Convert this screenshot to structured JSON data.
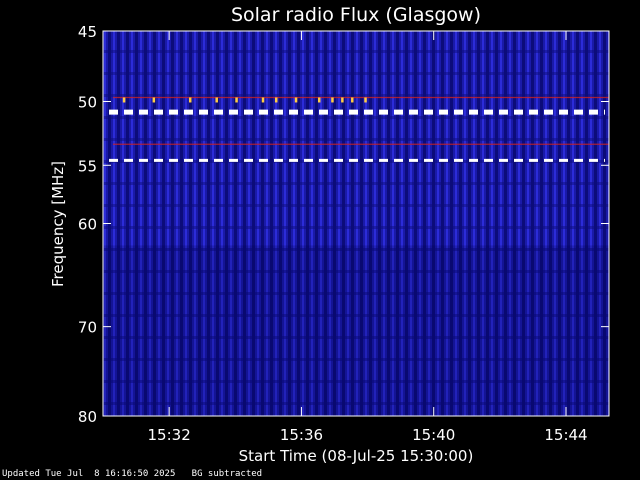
{
  "chart_data": {
    "type": "heatmap",
    "title": "Solar radio Flux (Glasgow)",
    "xlabel": "Start Time (08-Jul-25 15:30:00)",
    "ylabel": "Frequency [MHz]",
    "x_range_minutes": [
      0,
      15.3
    ],
    "x_ticks": [
      {
        "minute": 2,
        "label": "15:32"
      },
      {
        "minute": 6,
        "label": "15:36"
      },
      {
        "minute": 10,
        "label": "15:40"
      },
      {
        "minute": 14,
        "label": "15:44"
      }
    ],
    "y_range_mhz": [
      45,
      80
    ],
    "y_scale": "log",
    "y_ticks": [
      45,
      50,
      55,
      60,
      70,
      80
    ],
    "colors": {
      "background": "#000000",
      "plot_base": "#1a1aa8",
      "stripe_dark": "#0c0c7a",
      "stripe_bright": "#3a3aff",
      "rfi_line": "#ffffff",
      "rfi_hot": "#ffcc44",
      "rfi_red": "#cc2222"
    },
    "interference_lines_mhz": [
      50.8,
      54.6
    ],
    "faint_lines_mhz": [
      53.3,
      49.7
    ]
  },
  "footer": {
    "updated": "Updated Tue Jul  8 16:16:50 2025   BG subtracted"
  }
}
